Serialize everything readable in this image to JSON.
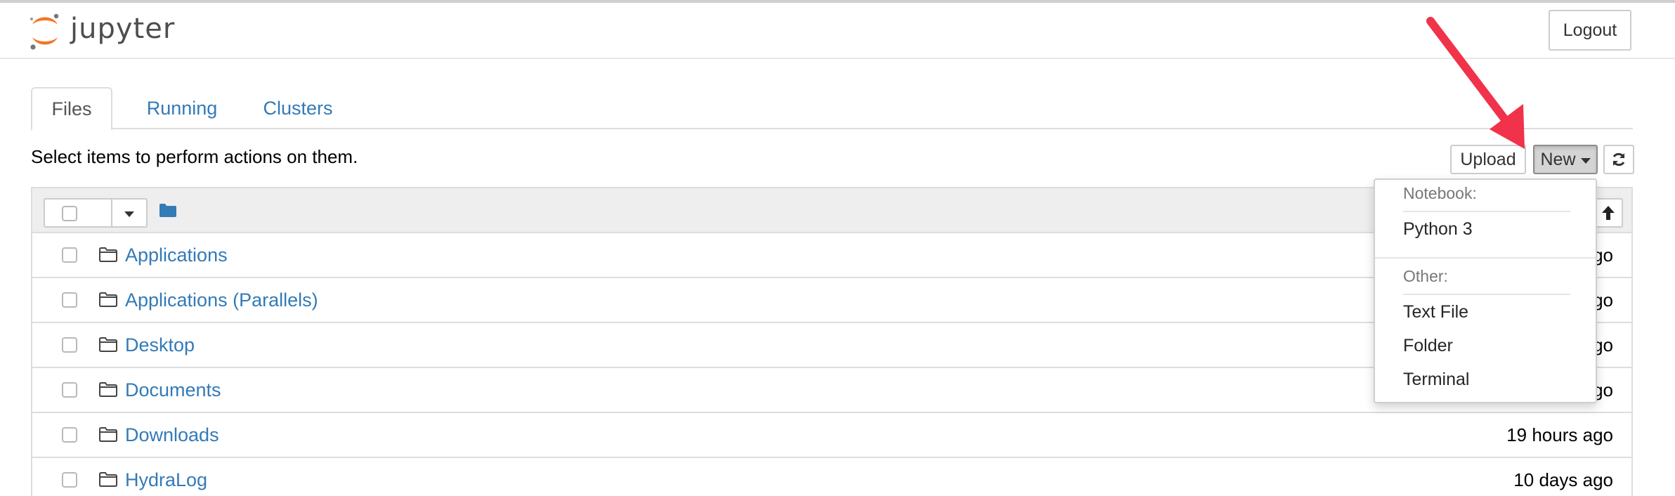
{
  "app": {
    "name": "jupyter",
    "logout_label": "Logout"
  },
  "tabs": [
    {
      "label": "Files",
      "active": true
    },
    {
      "label": "Running",
      "active": false
    },
    {
      "label": "Clusters",
      "active": false
    }
  ],
  "toolbar": {
    "hint": "Select items to perform actions on them.",
    "upload_label": "Upload",
    "new_label": "New",
    "refresh_icon": "refresh-icon"
  },
  "new_menu": {
    "notebook_header": "Notebook:",
    "notebook_items": [
      "Python 3"
    ],
    "other_header": "Other:",
    "other_items": [
      "Text File",
      "Folder",
      "Terminal"
    ]
  },
  "files": [
    {
      "name": "Applications",
      "modified": "ago"
    },
    {
      "name": "Applications (Parallels)",
      "modified": "ago"
    },
    {
      "name": "Desktop",
      "modified": "ago"
    },
    {
      "name": "Documents",
      "modified": "ago"
    },
    {
      "name": "Downloads",
      "modified": "19 hours ago"
    },
    {
      "name": "HydraLog",
      "modified": "10 days ago"
    }
  ],
  "annotation": {
    "arrow_color": "#f0334a"
  },
  "colors": {
    "link": "#337ab7",
    "logo_orange": "#f37726"
  }
}
